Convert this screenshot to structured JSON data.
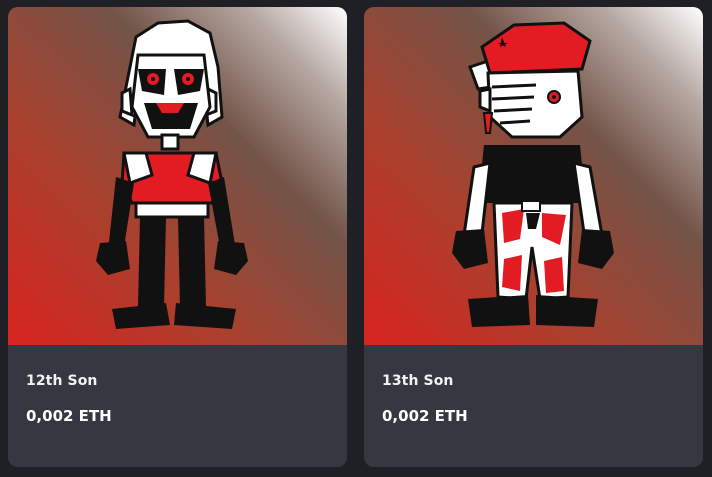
{
  "cards": [
    {
      "name": "12th Son",
      "price": "0,002 ETH"
    },
    {
      "name": "13th Son",
      "price": "0,002 ETH"
    }
  ],
  "colors": {
    "page_bg": "#1f2026",
    "card_bg": "#353741",
    "art_red": "#d42a22",
    "art_brown": "#7a5a4e",
    "accent_red": "#e31b23"
  }
}
